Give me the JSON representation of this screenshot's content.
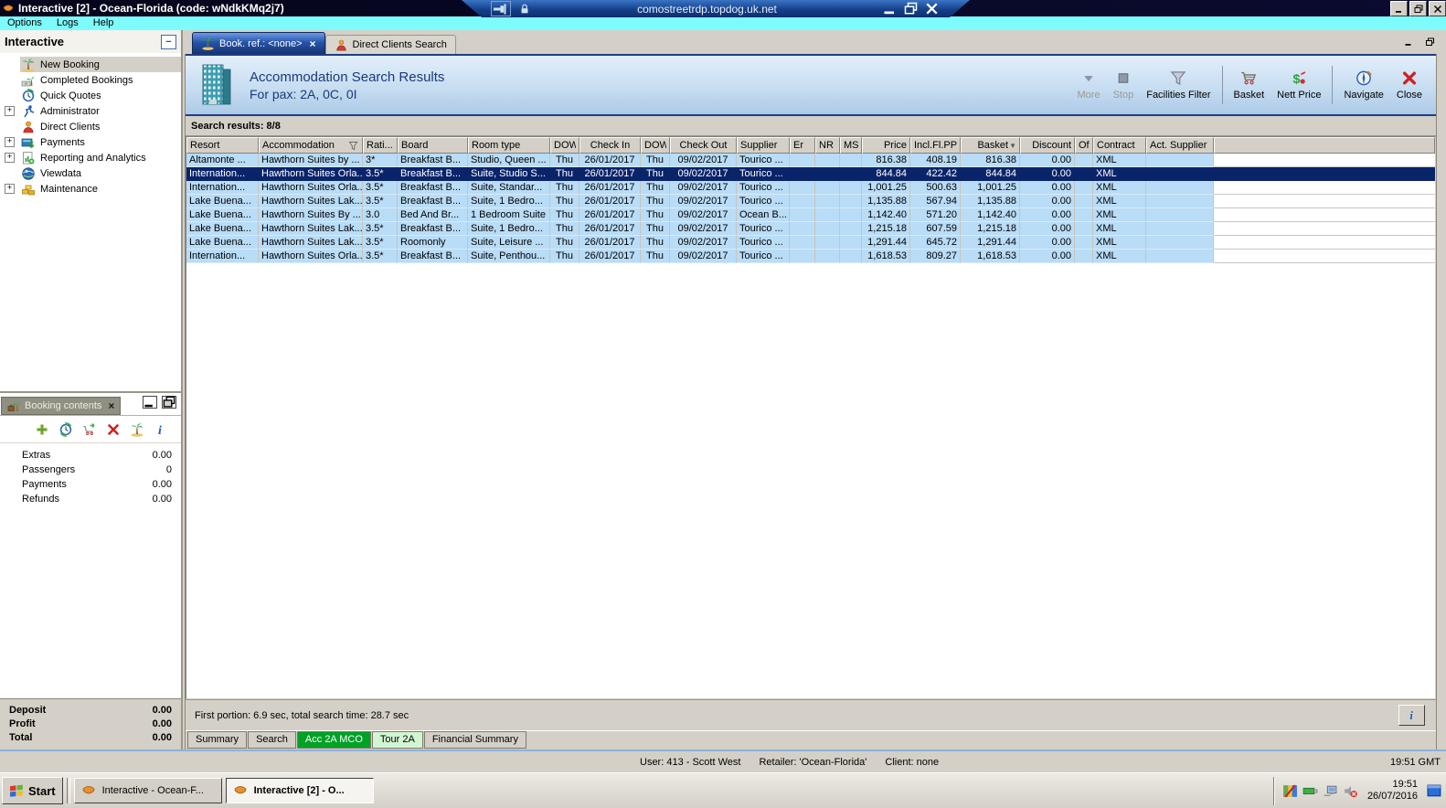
{
  "colors": {
    "selection_navy": "#0a246a",
    "row_blue": "#b9dcf7",
    "tab_green": "#00a226",
    "tab_pale_green": "#d2f5d2",
    "menu_cyan": "#7dfbfd",
    "header_navy": "#1a3a7a"
  },
  "window": {
    "title": "Interactive [2] - Ocean-Florida (code: wNdkKMq2j7)",
    "rdp": {
      "address": "comostreetrdp.topdog.uk.net"
    },
    "menu": [
      {
        "label": "Options"
      },
      {
        "label": "Logs"
      },
      {
        "label": "Help"
      }
    ]
  },
  "sidebar": {
    "title": "Interactive",
    "items": [
      {
        "label": "New Booking",
        "icon": "palm-tree-icon",
        "expandable": false,
        "selected": true
      },
      {
        "label": "Completed Bookings",
        "icon": "palm-money-icon",
        "expandable": false,
        "selected": false
      },
      {
        "label": "Quick Quotes",
        "icon": "clock-icon",
        "expandable": false,
        "selected": false
      },
      {
        "label": "Administrator",
        "icon": "runner-icon",
        "expandable": true,
        "selected": false
      },
      {
        "label": "Direct Clients",
        "icon": "person-icon",
        "expandable": false,
        "selected": false
      },
      {
        "label": "Payments",
        "icon": "payments-icon",
        "expandable": true,
        "selected": false
      },
      {
        "label": "Reporting and Analytics",
        "icon": "report-icon",
        "expandable": true,
        "selected": false
      },
      {
        "label": "Viewdata",
        "icon": "globe-icon",
        "expandable": false,
        "selected": false
      },
      {
        "label": "Maintenance",
        "icon": "maintenance-icon",
        "expandable": true,
        "selected": false
      }
    ]
  },
  "booking_panel": {
    "title": "Booking contents",
    "close_glyph": "×",
    "tools": [
      {
        "icon": "add-icon"
      },
      {
        "icon": "quote-clock-icon"
      },
      {
        "icon": "cart-arrow-icon"
      },
      {
        "icon": "delete-icon"
      },
      {
        "icon": "palm-tree-icon"
      },
      {
        "icon": "info-icon"
      }
    ],
    "rows": [
      {
        "label": "Extras",
        "value": "0.00"
      },
      {
        "label": "Passengers",
        "value": "0"
      },
      {
        "label": "Payments",
        "value": "0.00"
      },
      {
        "label": "Refunds",
        "value": "0.00"
      }
    ],
    "summary": [
      {
        "label": "Deposit",
        "value": "0.00"
      },
      {
        "label": "Profit",
        "value": "0.00"
      },
      {
        "label": "Total",
        "value": "0.00"
      }
    ]
  },
  "workspace": {
    "tabs": [
      {
        "label": "Book. ref.: <none>",
        "icon": "palm-tree-icon",
        "active": true,
        "closable": true,
        "close_glyph": "×"
      },
      {
        "label": "Direct Clients Search",
        "icon": "person-icon",
        "active": false,
        "closable": false
      }
    ],
    "header": {
      "title": "Accommodation Search Results",
      "subtitle": "For pax: 2A, 0C, 0I"
    },
    "toolbar": [
      {
        "label": "More",
        "icon": "down-arrow-icon",
        "disabled": true,
        "sep_after": false
      },
      {
        "label": "Stop",
        "icon": "stop-icon",
        "disabled": true,
        "sep_after": false
      },
      {
        "label": "Facilities Filter",
        "icon": "funnel-icon",
        "disabled": false,
        "sep_after": true
      },
      {
        "label": "Basket",
        "icon": "basket-icon",
        "disabled": false,
        "sep_after": false
      },
      {
        "label": "Nett Price",
        "icon": "nett-price-icon",
        "disabled": false,
        "sep_after": true
      },
      {
        "label": "Navigate",
        "icon": "navigate-icon",
        "disabled": false,
        "sep_after": false
      },
      {
        "label": "Close",
        "icon": "close-icon",
        "disabled": false,
        "sep_after": false
      }
    ],
    "results_label": "Search results: 8/8",
    "footer_status": "First portion: 6.9 sec, total search time: 28.7 sec",
    "bottom_tabs": [
      {
        "label": "Summary",
        "style": "plain"
      },
      {
        "label": "Search",
        "style": "plain"
      },
      {
        "label": "Acc 2A MCO",
        "style": "active-green"
      },
      {
        "label": "Tour 2A",
        "style": "pale-green"
      },
      {
        "label": "Financial Summary",
        "style": "plain"
      }
    ]
  },
  "table": {
    "columns": [
      {
        "label": "Resort"
      },
      {
        "label": "Accommodation",
        "filter_icon": true
      },
      {
        "label": "Rati..."
      },
      {
        "label": "Board"
      },
      {
        "label": "Room type"
      },
      {
        "label": "DOW"
      },
      {
        "label": "Check In"
      },
      {
        "label": "DOW"
      },
      {
        "label": "Check Out"
      },
      {
        "label": "Supplier"
      },
      {
        "label": "Er"
      },
      {
        "label": "NR"
      },
      {
        "label": "MS"
      },
      {
        "label": "Price"
      },
      {
        "label": "Incl.Fl.PP"
      },
      {
        "label": "Basket",
        "sort_icon": true
      },
      {
        "label": "Discount"
      },
      {
        "label": "Of"
      },
      {
        "label": "Contract"
      },
      {
        "label": "Act. Supplier"
      }
    ],
    "rows": [
      {
        "selected": false,
        "cells": [
          "Altamonte ...",
          "Hawthorn Suites by ...",
          "3*",
          "Breakfast B...",
          "Studio, Queen ...",
          "Thu",
          "26/01/2017",
          "Thu",
          "09/02/2017",
          "Tourico ...",
          "",
          "",
          "",
          "816.38",
          "408.19",
          "816.38",
          "0.00",
          "",
          "XML",
          ""
        ]
      },
      {
        "selected": true,
        "cells": [
          "Internation...",
          "Hawthorn Suites Orla...",
          "3.5*",
          "Breakfast B...",
          "Suite, Studio S...",
          "Thu",
          "26/01/2017",
          "Thu",
          "09/02/2017",
          "Tourico ...",
          "",
          "",
          "",
          "844.84",
          "422.42",
          "844.84",
          "0.00",
          "",
          "XML",
          ""
        ]
      },
      {
        "selected": false,
        "cells": [
          "Internation...",
          "Hawthorn Suites Orla...",
          "3.5*",
          "Breakfast B...",
          "Suite, Standar...",
          "Thu",
          "26/01/2017",
          "Thu",
          "09/02/2017",
          "Tourico ...",
          "",
          "",
          "",
          "1,001.25",
          "500.63",
          "1,001.25",
          "0.00",
          "",
          "XML",
          ""
        ]
      },
      {
        "selected": false,
        "cells": [
          "Lake Buena...",
          "Hawthorn Suites Lak...",
          "3.5*",
          "Breakfast B...",
          "Suite, 1 Bedro...",
          "Thu",
          "26/01/2017",
          "Thu",
          "09/02/2017",
          "Tourico ...",
          "",
          "",
          "",
          "1,135.88",
          "567.94",
          "1,135.88",
          "0.00",
          "",
          "XML",
          ""
        ]
      },
      {
        "selected": false,
        "cells": [
          "Lake Buena...",
          "Hawthorn Suites By ...",
          "3.0",
          "Bed And Br...",
          "1 Bedroom Suite",
          "Thu",
          "26/01/2017",
          "Thu",
          "09/02/2017",
          "Ocean B...",
          "",
          "",
          "",
          "1,142.40",
          "571.20",
          "1,142.40",
          "0.00",
          "",
          "XML",
          ""
        ]
      },
      {
        "selected": false,
        "cells": [
          "Lake Buena...",
          "Hawthorn Suites Lak...",
          "3.5*",
          "Breakfast B...",
          "Suite, 1 Bedro...",
          "Thu",
          "26/01/2017",
          "Thu",
          "09/02/2017",
          "Tourico ...",
          "",
          "",
          "",
          "1,215.18",
          "607.59",
          "1,215.18",
          "0.00",
          "",
          "XML",
          ""
        ]
      },
      {
        "selected": false,
        "cells": [
          "Lake Buena...",
          "Hawthorn Suites Lak...",
          "3.5*",
          "Roomonly",
          "Suite, Leisure ...",
          "Thu",
          "26/01/2017",
          "Thu",
          "09/02/2017",
          "Tourico ...",
          "",
          "",
          "",
          "1,291.44",
          "645.72",
          "1,291.44",
          "0.00",
          "",
          "XML",
          ""
        ]
      },
      {
        "selected": false,
        "cells": [
          "Internation...",
          "Hawthorn Suites Orla...",
          "3.5*",
          "Breakfast B...",
          "Suite, Penthou...",
          "Thu",
          "26/01/2017",
          "Thu",
          "09/02/2017",
          "Tourico ...",
          "",
          "",
          "",
          "1,618.53",
          "809.27",
          "1,618.53",
          "0.00",
          "",
          "XML",
          ""
        ]
      }
    ]
  },
  "statusbar": {
    "user": "User: 413 - Scott West",
    "retailer": "Retailer: 'Ocean-Florida'",
    "client": "Client: none",
    "time": "19:51 GMT"
  },
  "taskbar": {
    "start_label": "Start",
    "items": [
      {
        "label": "Interactive - Ocean-F...",
        "icon": "app-icon",
        "active": false
      },
      {
        "label": "Interactive [2] - O...",
        "icon": "app-icon",
        "active": true
      }
    ],
    "tray": {
      "icons": [
        "antivirus-icon",
        "network-icon",
        "computer-icon",
        "speaker-muted-icon"
      ],
      "time": "19:51",
      "date": "26/07/2016",
      "edge_icon": "blue-window-icon"
    }
  }
}
